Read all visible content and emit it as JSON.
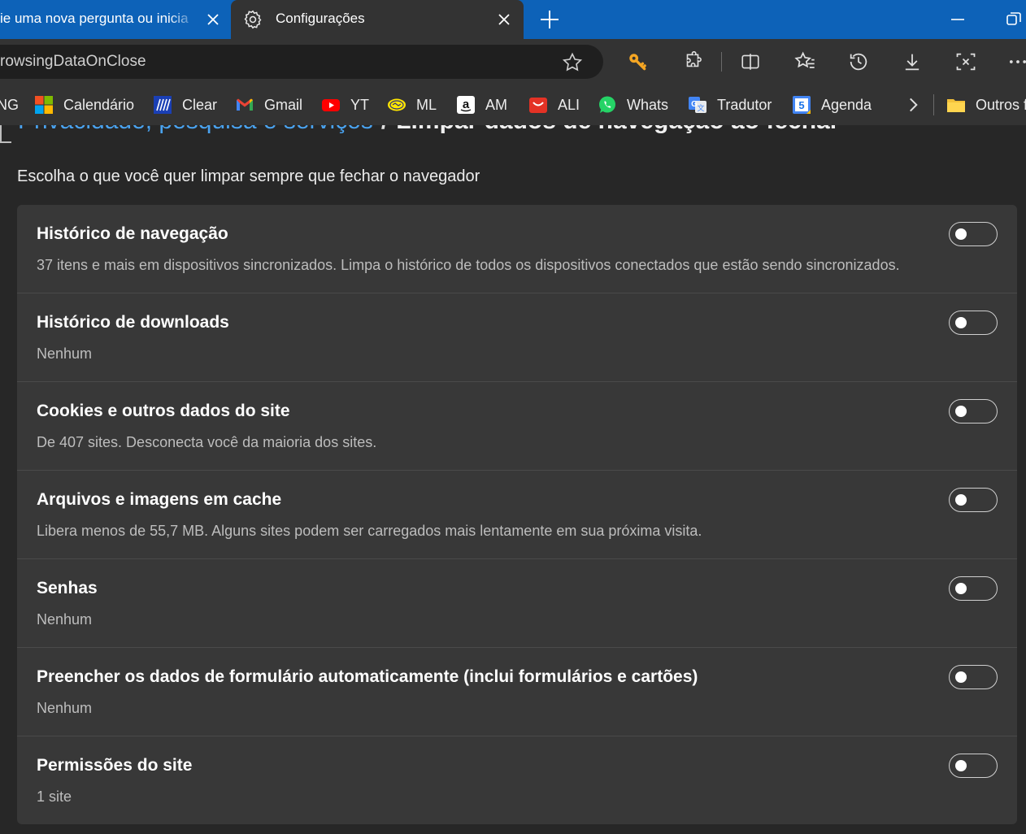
{
  "tabs": {
    "inactive_title": "ie uma nova pergunta ou inicia",
    "active_title": "Configurações"
  },
  "toolbar": {
    "url": "rowsingDataOnClose"
  },
  "favorites": [
    {
      "label": "NG",
      "icon": "bing-icon"
    },
    {
      "label": "Calendário",
      "icon": "microsoft-logo-icon"
    },
    {
      "label": "Clear",
      "icon": "clear-icon"
    },
    {
      "label": "Gmail",
      "icon": "gmail-icon"
    },
    {
      "label": "YT",
      "icon": "youtube-icon"
    },
    {
      "label": "ML",
      "icon": "mercadolivre-icon"
    },
    {
      "label": "AM",
      "icon": "amazon-icon"
    },
    {
      "label": "ALI",
      "icon": "aliexpress-icon"
    },
    {
      "label": "Whats",
      "icon": "whatsapp-icon"
    },
    {
      "label": "Tradutor",
      "icon": "translate-icon"
    },
    {
      "label": "Agenda",
      "icon": "calendar-icon"
    },
    {
      "label": "Outros f",
      "icon": "folder-icon"
    }
  ],
  "breadcrumb": {
    "parent": "Privacidade, pesquisa e serviços",
    "separator": "/",
    "current": "Limpar dados de navegação ao fechar"
  },
  "page": {
    "description": "Escolha o que você quer limpar sempre que fechar o navegador"
  },
  "settings": [
    {
      "title": "Histórico de navegação",
      "desc": "37 itens e mais em dispositivos sincronizados. Limpa o histórico de todos os dispositivos conectados que estão sendo sincronizados.",
      "enabled": false
    },
    {
      "title": "Histórico de downloads",
      "desc": "Nenhum",
      "enabled": false
    },
    {
      "title": "Cookies e outros dados do site",
      "desc": "De 407 sites. Desconecta você da maioria dos sites.",
      "enabled": false
    },
    {
      "title": "Arquivos e imagens em cache",
      "desc": "Libera menos de 55,7 MB. Alguns sites podem ser carregados mais lentamente em sua próxima visita.",
      "enabled": false
    },
    {
      "title": "Senhas",
      "desc": "Nenhum",
      "enabled": false
    },
    {
      "title": "Preencher os dados de formulário automaticamente (inclui formulários e cartões)",
      "desc": "Nenhum",
      "enabled": false
    },
    {
      "title": "Permissões do site",
      "desc": "1 site",
      "enabled": false
    }
  ],
  "colors": {
    "titlebar": "#0d62b8",
    "toolbar": "#333333",
    "page_bg": "#272727",
    "card_bg": "#383838",
    "link": "#4aa3f0"
  }
}
